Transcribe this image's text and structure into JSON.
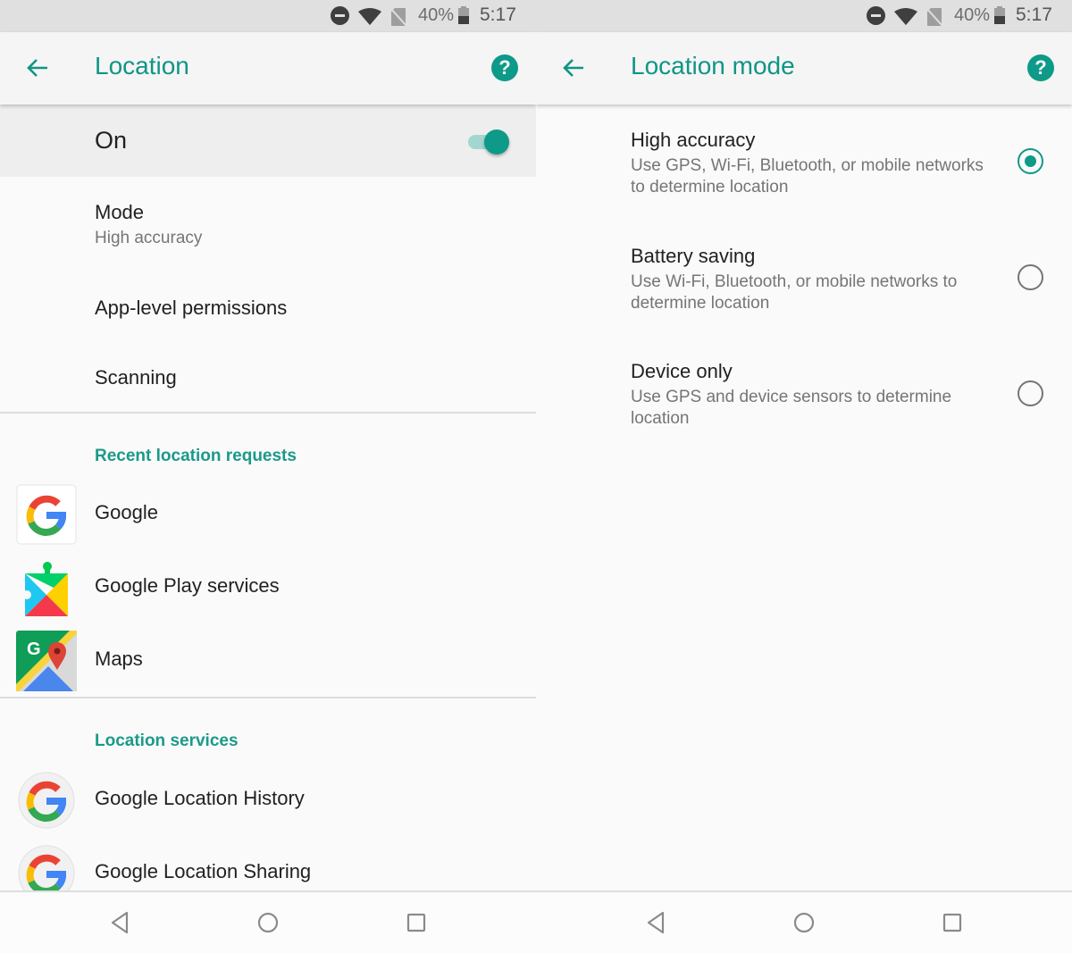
{
  "status_bar": {
    "battery_percent": "40%",
    "time": "5:17",
    "icons": [
      "do-not-disturb-icon",
      "wifi-icon",
      "no-sim-icon",
      "battery-icon"
    ]
  },
  "colors": {
    "accent": "#0e9a88",
    "status_bar_bg": "#e0e0e0",
    "app_bar_bg": "#f5f5f5",
    "primary_text": "#212121",
    "secondary_text": "#757575"
  },
  "left": {
    "app_bar": {
      "title": "Location",
      "back_icon": "arrow-left-icon",
      "help_icon": "help-icon"
    },
    "master_switch": {
      "label": "On",
      "checked": true
    },
    "prefs": [
      {
        "title": "Mode",
        "summary": "High accuracy"
      },
      {
        "title": "App-level permissions"
      },
      {
        "title": "Scanning"
      }
    ],
    "recent_requests": {
      "header": "Recent location requests",
      "apps": [
        {
          "label": "Google",
          "icon": "google-icon"
        },
        {
          "label": "Google Play services",
          "icon": "google-play-services-icon"
        },
        {
          "label": "Maps",
          "icon": "google-maps-icon"
        }
      ]
    },
    "location_services": {
      "header": "Location services",
      "items": [
        {
          "label": "Google Location History",
          "icon": "google-icon"
        },
        {
          "label": "Google Location Sharing",
          "icon": "google-icon"
        }
      ]
    }
  },
  "right": {
    "app_bar": {
      "title": "Location mode",
      "back_icon": "arrow-left-icon",
      "help_icon": "help-icon"
    },
    "options": [
      {
        "title": "High accuracy",
        "description": "Use GPS, Wi-Fi, Bluetooth, or mobile networks to determine location",
        "selected": true
      },
      {
        "title": "Battery saving",
        "description": "Use Wi-Fi, Bluetooth, or mobile networks to determine location",
        "selected": false
      },
      {
        "title": "Device only",
        "description": "Use GPS and device sensors to determine location",
        "selected": false
      }
    ]
  },
  "nav_bar": {
    "buttons": [
      "back-icon",
      "home-icon",
      "recents-icon"
    ]
  }
}
